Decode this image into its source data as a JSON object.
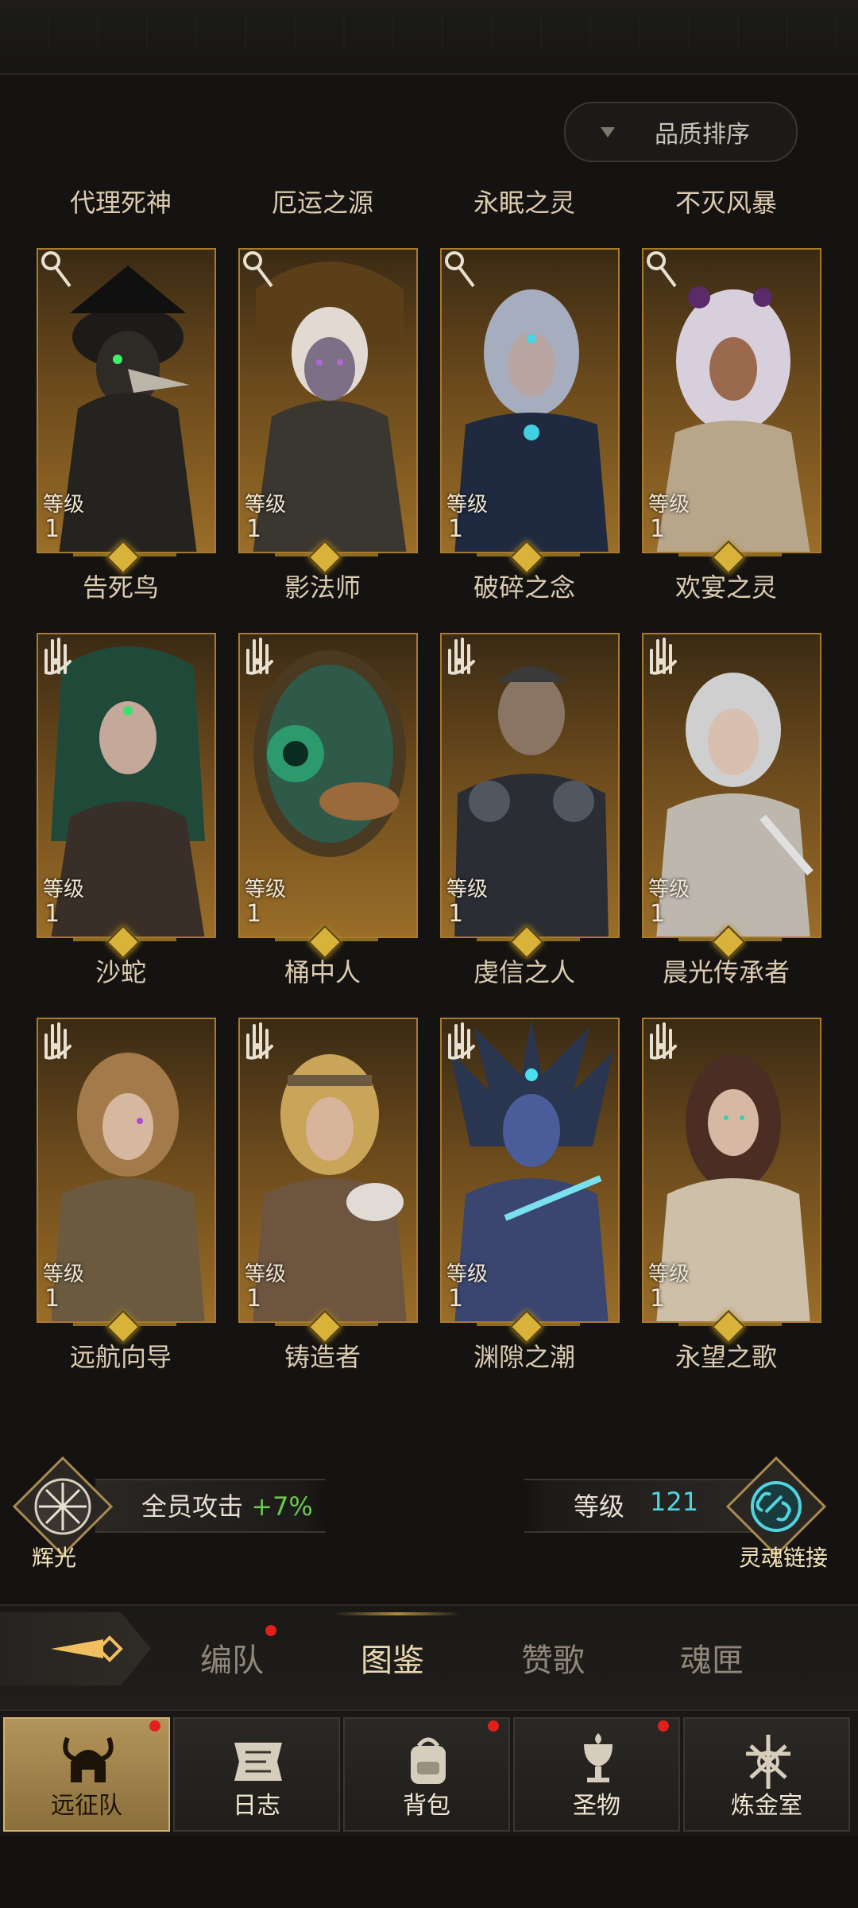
{
  "sort": {
    "label": "品质排序"
  },
  "level_label": "等级",
  "cards": [
    {
      "title": "代理死神",
      "name": "告死鸟",
      "level": "1",
      "type": "staff"
    },
    {
      "title": "厄运之源",
      "name": "影法师",
      "level": "1",
      "type": "staff"
    },
    {
      "title": "永眠之灵",
      "name": "破碎之念",
      "level": "1",
      "type": "staff"
    },
    {
      "title": "不灭风暴",
      "name": "欢宴之灵",
      "level": "1",
      "type": "staff"
    },
    {
      "title": "告死鸟",
      "name": "沙蛇",
      "level": "1",
      "type": "hand"
    },
    {
      "title": "影法师",
      "name": "桶中人",
      "level": "1",
      "type": "hand"
    },
    {
      "title": "破碎之念",
      "name": "虔信之人",
      "level": "1",
      "type": "hand"
    },
    {
      "title": "欢宴之灵",
      "name": "晨光传承者",
      "level": "1",
      "type": "hand"
    },
    {
      "title": "沙蛇",
      "name": "远航向导",
      "level": "1",
      "type": "hand"
    },
    {
      "title": "桶中人",
      "name": "铸造者",
      "level": "1",
      "type": "hand"
    },
    {
      "title": "虔信之人",
      "name": "渊隙之潮",
      "level": "1",
      "type": "hand"
    },
    {
      "title": "晨光传承者",
      "name": "永望之歌",
      "level": "1",
      "type": "hand"
    }
  ],
  "row_titles_bottom": [
    "远航向导",
    "铸造者",
    "渊隙之潮",
    "永望之歌"
  ],
  "bonus": {
    "emblem_name": "辉光",
    "text": "全员攻击",
    "value": "+7%"
  },
  "soul_link": {
    "level_label": "等级",
    "level_value": "121",
    "name": "灵魂链接"
  },
  "tabs": [
    {
      "label": "编队",
      "badge": true
    },
    {
      "label": "图鉴",
      "active": true
    },
    {
      "label": "赞歌"
    },
    {
      "label": "魂匣"
    }
  ],
  "nav": [
    {
      "label": "远征队",
      "icon": "helmet-icon",
      "active": true,
      "badge": true
    },
    {
      "label": "日志",
      "icon": "scroll-icon",
      "badge": false
    },
    {
      "label": "背包",
      "icon": "backpack-icon",
      "badge": true
    },
    {
      "label": "圣物",
      "icon": "chalice-icon",
      "badge": true
    },
    {
      "label": "炼金室",
      "icon": "alchemy-icon",
      "badge": false
    }
  ],
  "colors": {
    "gold": "#a77a2e",
    "accent_green": "#69c94f",
    "accent_cyan": "#4fd4e0",
    "badge_red": "#e0201c"
  }
}
